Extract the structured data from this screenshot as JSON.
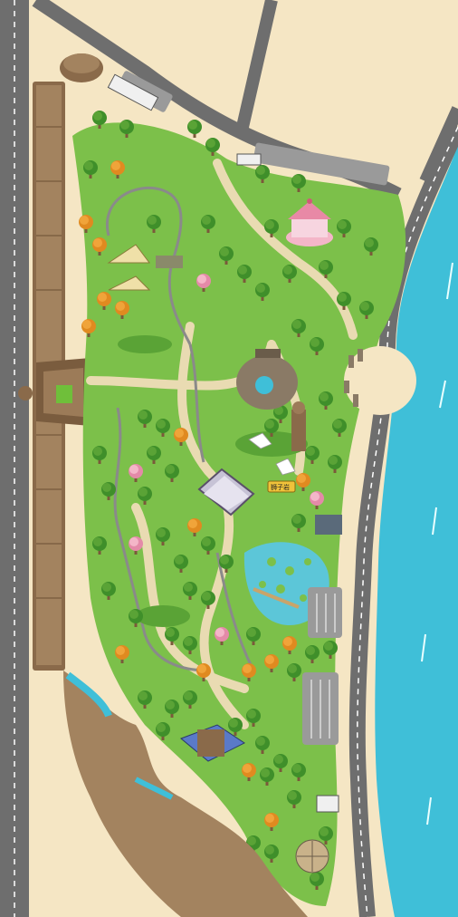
{
  "map": {
    "sign_label": "狮子岩"
  },
  "colors": {
    "sand": "#f5e6c4",
    "grass": "#7cc04a",
    "grass_dark": "#5aa336",
    "water": "#3fbfd8",
    "road": "#6e6e6e",
    "path": "#e9dbb2",
    "tree": "#3f8f2a",
    "tree_light": "#8fd05a",
    "autumn": "#f0a43a",
    "blossom": "#f4b6c8",
    "wall": "#8a6a4a",
    "pond": "#5cc6d8"
  }
}
